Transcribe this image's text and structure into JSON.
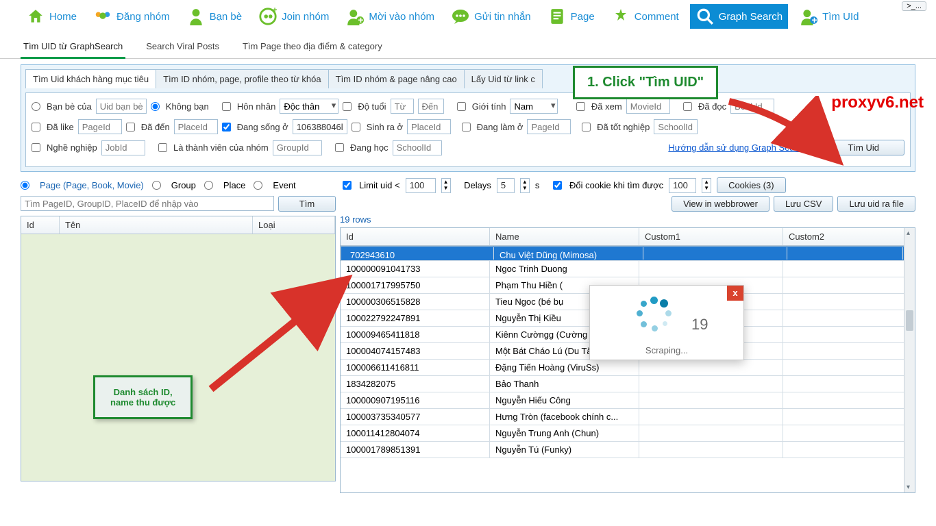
{
  "nav": {
    "items": [
      {
        "label": "Home"
      },
      {
        "label": "Đăng nhóm"
      },
      {
        "label": "Bạn bè"
      },
      {
        "label": "Join nhóm"
      },
      {
        "label": "Mời vào nhóm"
      },
      {
        "label": "Gửi tin nhắn"
      },
      {
        "label": "Page"
      },
      {
        "label": "Comment"
      },
      {
        "label": "Graph Search"
      },
      {
        "label": "Tìm UId"
      }
    ]
  },
  "subtabs": [
    "Tìm UID từ GraphSearch",
    "Search Viral Posts",
    "Tìm Page theo địa điểm & category"
  ],
  "innertabs": [
    "Tìm Uid khách hàng mục tiêu",
    "Tìm ID nhóm, page, profile theo từ khóa",
    "Tìm ID nhóm & page nâng cao",
    "Lấy Uid từ link c"
  ],
  "filters": {
    "ban_be_cua": "Bạn bè của",
    "uid_ban_be_ph": "Uid bạn bè",
    "khong_ban": "Không bạn",
    "hon_nhan": "Hôn nhân",
    "hon_nhan_val": "Độc thân",
    "do_tuoi": "Độ tuổi",
    "tu_ph": "Từ",
    "den_ph": "Đến",
    "gioi_tinh": "Giới tính",
    "gioi_tinh_val": "Nam",
    "da_xem": "Đã xem",
    "movieid_ph": "MovieId",
    "da_doc": "Đã đọc",
    "bookid_ph": "BookId",
    "da_like": "Đã like",
    "pageid_ph": "PageId",
    "da_den": "Đã đến",
    "placeid_ph": "PlaceId",
    "dang_song_o": "Đang sống ở",
    "dang_song_val": "106388046l",
    "sinh_ra_o": "Sinh ra ở",
    "dang_lam_o": "Đang làm ở",
    "da_tot_nghiep": "Đã tốt nghiệp",
    "schoolid_ph": "SchoolId",
    "nghe_nghiep": "Nghề nghiệp",
    "jobid_ph": "JobId",
    "la_thanh_vien": "Là thành viên của nhóm",
    "groupid_ph": "GroupId",
    "dang_hoc": "Đang học",
    "guide_link": "Hướng dẫn sử dụng Graph Search",
    "tim_uid_btn": "Tìm Uid"
  },
  "leftopts": {
    "page": "Page (Page, Book, Movie)",
    "group": "Group",
    "place": "Place",
    "event": "Event",
    "search_ph": "Tìm PageID, GroupID, PlaceID để nhập vào",
    "tim_btn": "Tìm"
  },
  "rightopts": {
    "limit_label": "Limit uid <",
    "limit_val": "100",
    "delays_label": "Delays",
    "delays_val": "5",
    "s": "s",
    "cookie_label": "Đổi cookie khi tìm được",
    "cookie_val": "100",
    "cookies_btn": "Cookies (3)",
    "view_btn": "View in webbrower",
    "csv_btn": "Lưu CSV",
    "file_btn": "Lưu uid ra file",
    "rowcount": "19 rows"
  },
  "leftgrid": {
    "cols": [
      "Id",
      "Tên",
      "Loại"
    ]
  },
  "rightgrid": {
    "cols": [
      "Id",
      "Name",
      "Custom1",
      "Custom2"
    ],
    "rows": [
      {
        "id": "702943610",
        "name": "Chu Việt Dũng (Mimosa)"
      },
      {
        "id": "100000091041733",
        "name": "Ngoc Trinh Duong"
      },
      {
        "id": "100001717995750",
        "name": "Phạm Thu Hiền ("
      },
      {
        "id": "100000306515828",
        "name": "Tieu Ngoc (bé bụ"
      },
      {
        "id": "100022792247891",
        "name": "Nguyễn Thị Kiều"
      },
      {
        "id": "100009465411818",
        "name": "Kiênn Cườngg (Cường Sắt Vụn)"
      },
      {
        "id": "100004074157483",
        "name": "Một Bát Cháo Lú (Du Tăng)"
      },
      {
        "id": "100006611416811",
        "name": "Đặng Tiến Hoàng (ViruSs)"
      },
      {
        "id": "1834282075",
        "name": "Bảo Thanh"
      },
      {
        "id": "100000907195116",
        "name": "Nguyễn Hiếu Công"
      },
      {
        "id": "100003735340577",
        "name": "Hưng Tròn (facebook chính c..."
      },
      {
        "id": "100011412804074",
        "name": "Nguyễn Trung Anh (Chun)"
      },
      {
        "id": "100001789851391",
        "name": "Nguyễn Tú (Funky)"
      }
    ]
  },
  "popup": {
    "count": "19",
    "status": "Scraping...",
    "close": "x"
  },
  "callouts": {
    "c1": "1. Click \"Tìm UID\"",
    "c2a": "Danh sách ID,",
    "c2b": "name thu được"
  },
  "watermark": "proxyv6.net",
  "dropbtn": ">_..."
}
